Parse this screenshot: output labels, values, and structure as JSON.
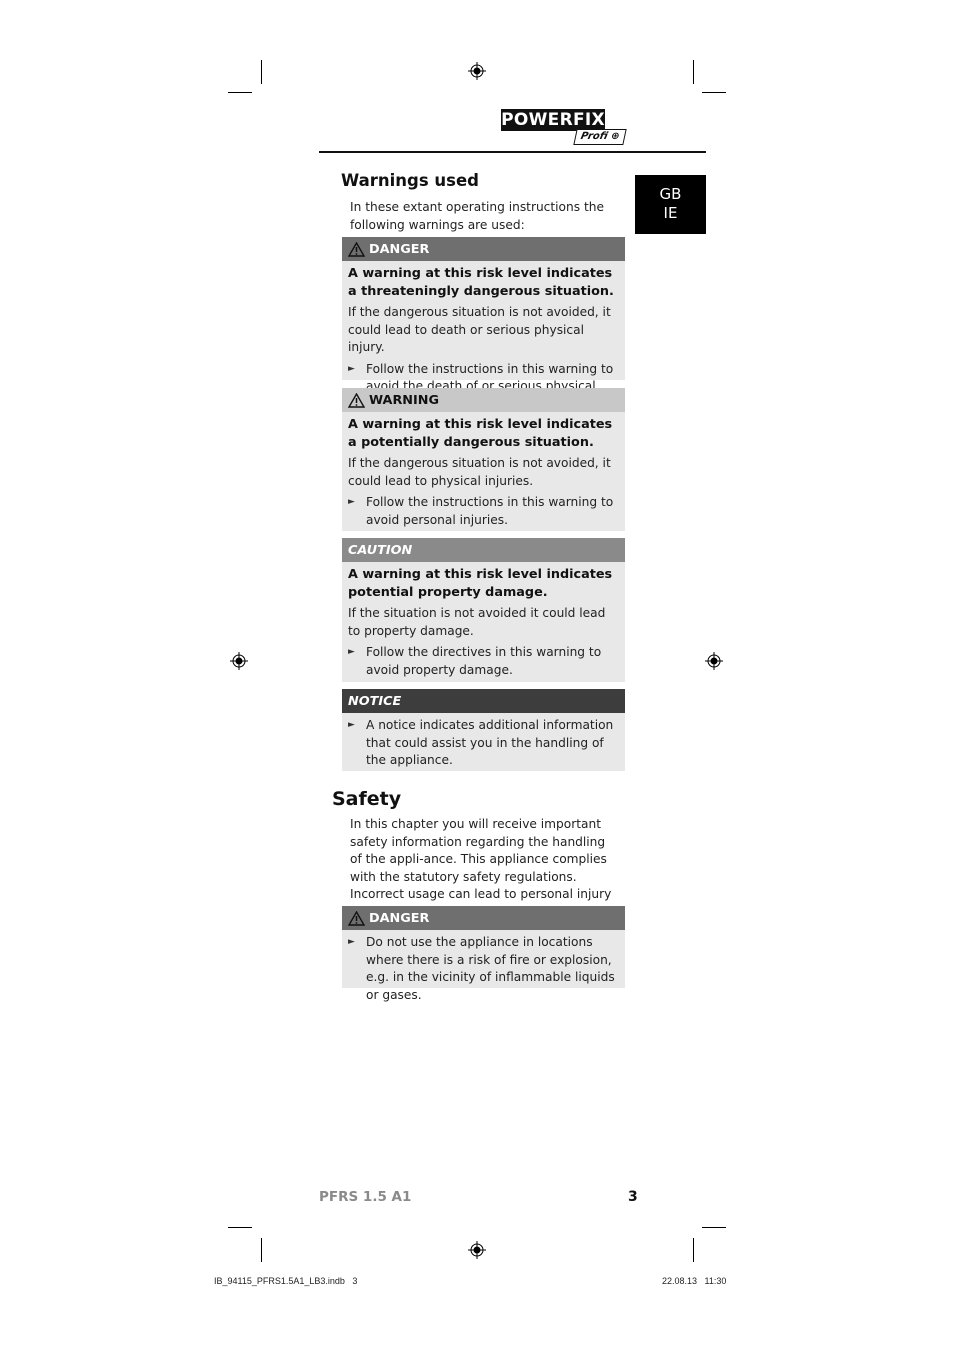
{
  "header": {
    "logo_text": "POWERFIX",
    "logo_sub": "Profi",
    "language_tab": [
      "GB",
      "IE"
    ]
  },
  "warnings_section": {
    "title": "Warnings used",
    "intro": "In these extant operating instructions the following warnings are used:",
    "boxes": [
      {
        "label": "DANGER",
        "icon": "warning-triangle-icon",
        "lead": "A warning at this risk level indicates a threateningly dangerous situation.",
        "text": "If the dangerous situation is not avoided, it could lead to death or serious physical injury.",
        "bullet": "Follow the instructions in this warning to avoid the death of or serious physical injury to people."
      },
      {
        "label": "WARNING",
        "icon": "warning-triangle-icon",
        "lead": "A warning at this risk level indicates a potentially dangerous situation.",
        "text": "If the dangerous situation is not avoided, it could lead to physical injuries.",
        "bullet": "Follow the instructions in this warning to avoid personal injuries."
      },
      {
        "label": "CAUTION",
        "lead": "A warning at this risk level indicates potential property damage.",
        "text": "If the situation is not avoided it could lead to property damage.",
        "bullet": "Follow the directives in this warning to avoid property damage."
      },
      {
        "label": "NOTICE",
        "bullet": "A notice indicates additional information that could assist you in the handling of the appliance."
      }
    ]
  },
  "safety_section": {
    "title": "Safety",
    "intro": "In this chapter you will receive important safety information regarding the handling of the appli-ance. This appliance complies with the statutory safety regulations. Incorrect usage can lead to personal injury and property damage.",
    "danger_box": {
      "label": "DANGER",
      "icon": "warning-triangle-icon",
      "bullet": "Do not use the appliance in locations where there is a risk of fire or explosion, e.g. in the vicinity of inflammable liquids or gases."
    }
  },
  "footer": {
    "model": "PFRS 1.5 A1",
    "page_number": "3",
    "slug_file": "IB_94115_PFRS1.5A1_LB3.indb   3",
    "slug_date": "22.08.13   11:30"
  },
  "colors": {
    "danger_bar": "#6f6f6f",
    "warning_bar": "#c8c8c8",
    "caution_bar": "#8a8a8a",
    "notice_bar": "#3d3d3d",
    "box_body": "#e8e8e8"
  }
}
